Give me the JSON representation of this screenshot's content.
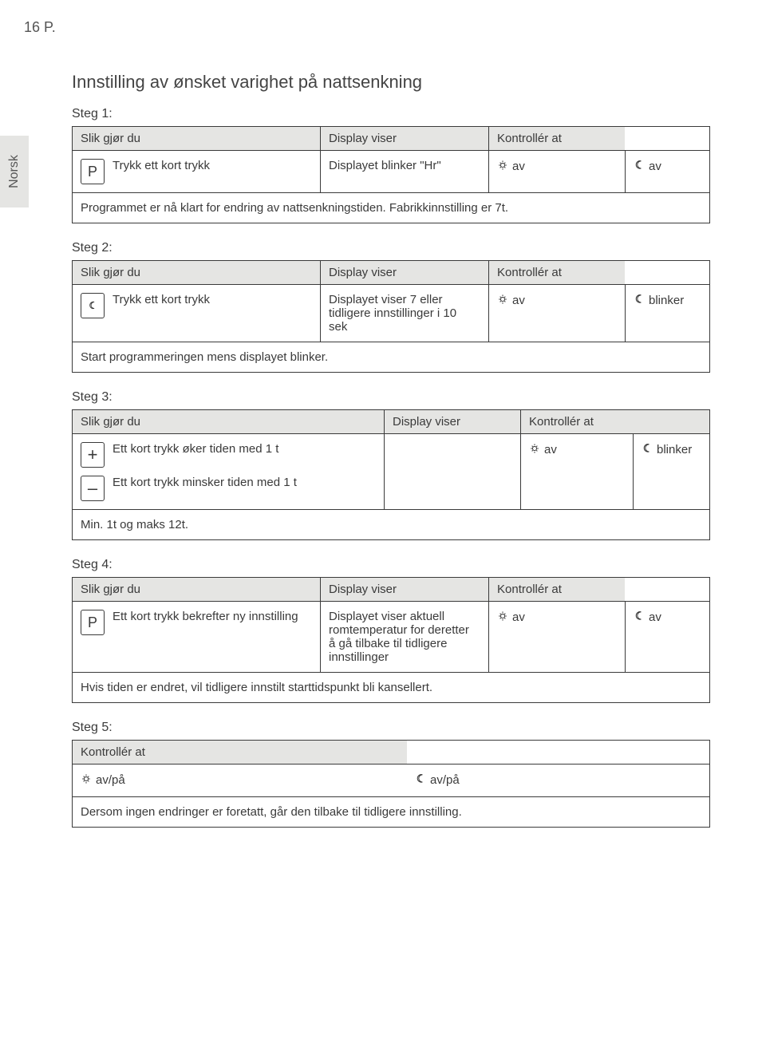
{
  "page_number": "16 P.",
  "side_tab": "Norsk",
  "heading": "Innstilling av ønsket varighet på nattsenkning",
  "headers": {
    "action": "Slik gjør du",
    "display": "Display viser",
    "check": "Kontrollér at"
  },
  "icons": {
    "sun_state_off": "av",
    "moon_state_off": "av",
    "moon_state_blink": "blinker",
    "sun_state_onoff": "av/på",
    "moon_state_onoff": "av/på"
  },
  "keys": {
    "P": "P",
    "plus": "+",
    "minus": "–"
  },
  "step1": {
    "label": "Steg 1:",
    "action": "Trykk ett kort trykk",
    "display": "Displayet blinker \"Hr\"",
    "foot": "Programmet er nå klart for endring av nattsenkningstiden. Fabrikkinnstilling er 7t."
  },
  "step2": {
    "label": "Steg 2:",
    "action": "Trykk ett kort trykk",
    "display": "Displayet viser 7 eller tidligere innstillinger i 10 sek",
    "foot": "Start programmeringen mens displayet blinker."
  },
  "step3": {
    "label": "Steg 3:",
    "action_plus": "Ett kort trykk øker tiden med 1 t",
    "action_minus": "Ett kort trykk minsker tiden med 1 t",
    "foot": "Min. 1t og maks 12t."
  },
  "step4": {
    "label": "Steg 4:",
    "action": "Ett kort trykk bekrefter ny innstilling",
    "display": "Displayet viser aktuell romtemperatur for deretter å gå tilbake til tidligere innstillinger",
    "foot": "Hvis tiden er endret, vil tidligere innstilt starttidspunkt bli kansellert."
  },
  "step5": {
    "label": "Steg 5:",
    "foot": "Dersom ingen endringer er foretatt, går den tilbake til tidligere innstilling."
  }
}
